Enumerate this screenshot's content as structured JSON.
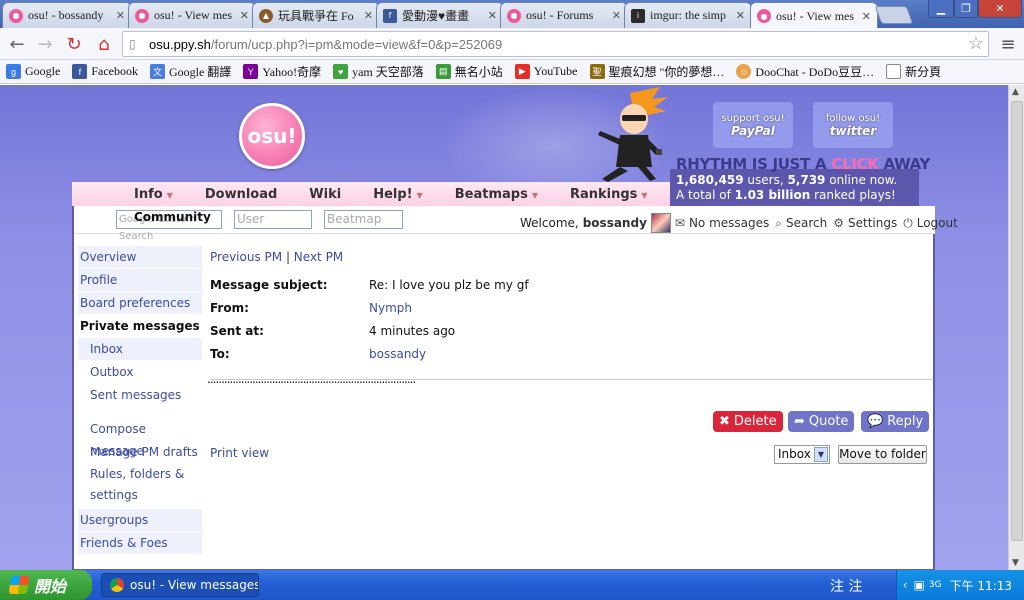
{
  "browser": {
    "tabs": [
      {
        "title": "osu! - bossandy",
        "favicon_color": "#f0589c",
        "favicon": "osu-icon",
        "active": false
      },
      {
        "title": "osu! - View mes",
        "favicon_color": "#f0589c",
        "favicon": "osu-icon",
        "active": false
      },
      {
        "title": "玩具戰爭在 Fo",
        "favicon_color": "#8a5a2b",
        "favicon": "toy-icon",
        "active": false
      },
      {
        "title": "愛動漫♥畫畫",
        "favicon_color": "#3b5998",
        "favicon": "facebook-icon",
        "active": false
      },
      {
        "title": "osu! - Forums",
        "favicon_color": "#f0589c",
        "favicon": "osu-icon",
        "active": false
      },
      {
        "title": "imgur: the simp",
        "favicon_color": "#2b2b2b",
        "favicon": "imgur-icon",
        "active": false
      },
      {
        "title": "osu! - View mes",
        "favicon_color": "#f0589c",
        "favicon": "osu-icon",
        "active": true
      }
    ],
    "url_host": "osu.ppy.sh",
    "url_path": "/forum/ucp.php?i=pm&mode=view&f=0&p=252069",
    "bookmarks": [
      {
        "label": "Google",
        "icon": "google-icon",
        "color": "#3b7be8"
      },
      {
        "label": "Facebook",
        "icon": "facebook-icon",
        "color": "#3b5998"
      },
      {
        "label": "Google 翻譯",
        "icon": "translate-icon",
        "color": "#4a7de0"
      },
      {
        "label": "Yahoo!奇摩",
        "icon": "yahoo-icon",
        "color": "#7b0099"
      },
      {
        "label": "yam 天空部落",
        "icon": "yam-icon",
        "color": "#3fa33f"
      },
      {
        "label": "無名小站",
        "icon": "wretch-icon",
        "color": "#3a9a3a"
      },
      {
        "label": "YouTube",
        "icon": "youtube-icon",
        "color": "#e52d27"
      },
      {
        "label": "聖痕幻想 \"你的夢想…",
        "icon": "game-icon",
        "color": "#8a6a10"
      },
      {
        "label": "DooChat - DoDo豆豆…",
        "icon": "doochat-icon",
        "color": "#e8a04a"
      },
      {
        "label": "新分頁",
        "icon": "page-icon",
        "color": "#ffffff"
      }
    ]
  },
  "header": {
    "logo_text": "osu!",
    "support_line1": "support osu!",
    "support_line2": "PayPal",
    "follow_line1": "follow osu!",
    "follow_line2": "twitter",
    "tagline_pre": "RHYTHM IS JUST A ",
    "tagline_click": "CLICK",
    "tagline_post": " AWAY",
    "users_count": "1,680,459",
    "users_label": " users, ",
    "online_count": "5,739",
    "online_label": " online now.",
    "plays_pre": "A total of ",
    "plays_count": "1.03 billion",
    "plays_post": " ranked plays!"
  },
  "mainnav": [
    "Info",
    "Download",
    "Wiki",
    "Help!",
    "Beatmaps",
    "Rankings"
  ],
  "subnav": {
    "community": "Community",
    "search_placeholder": "Google Custom Search",
    "user_placeholder": "User",
    "beatmap_placeholder": "Beatmap",
    "welcome": "Welcome,",
    "username": "bossandy",
    "messages": "No messages",
    "search": "Search",
    "settings": "Settings",
    "logout": "Logout"
  },
  "sidebar": {
    "items": [
      "Overview",
      "Profile",
      "Board preferences"
    ],
    "pm_heading": "Private messages",
    "pm_items": [
      "Inbox",
      "Outbox",
      "Sent messages"
    ],
    "pm_items2": [
      "Compose message",
      "Manage PM drafts",
      "Rules, folders &",
      "settings"
    ],
    "bottom_items": [
      "Usergroups",
      "Friends & Foes"
    ]
  },
  "message": {
    "prev": "Previous PM",
    "sep": " | ",
    "next": "Next PM",
    "subject_label": "Message subject:",
    "subject": "Re: I love you plz be my gf",
    "from_label": "From:",
    "from": "Nymph",
    "sent_label": "Sent at:",
    "sent": "4 minutes ago",
    "to_label": "To:",
    "to": "bossandy",
    "body": "..........................................................................",
    "delete": "Delete",
    "quote": "Quote",
    "reply": "Reply",
    "print": "Print view",
    "folder": "Inbox",
    "move": "Move to folder"
  },
  "colors": {
    "delete": "#d9263b",
    "quote": "#6f74c8",
    "reply": "#6f74c8"
  },
  "taskbar": {
    "start": "開始",
    "task": "osu! - View messages -...",
    "ime": "注 注",
    "clock": "下午 11:13"
  }
}
